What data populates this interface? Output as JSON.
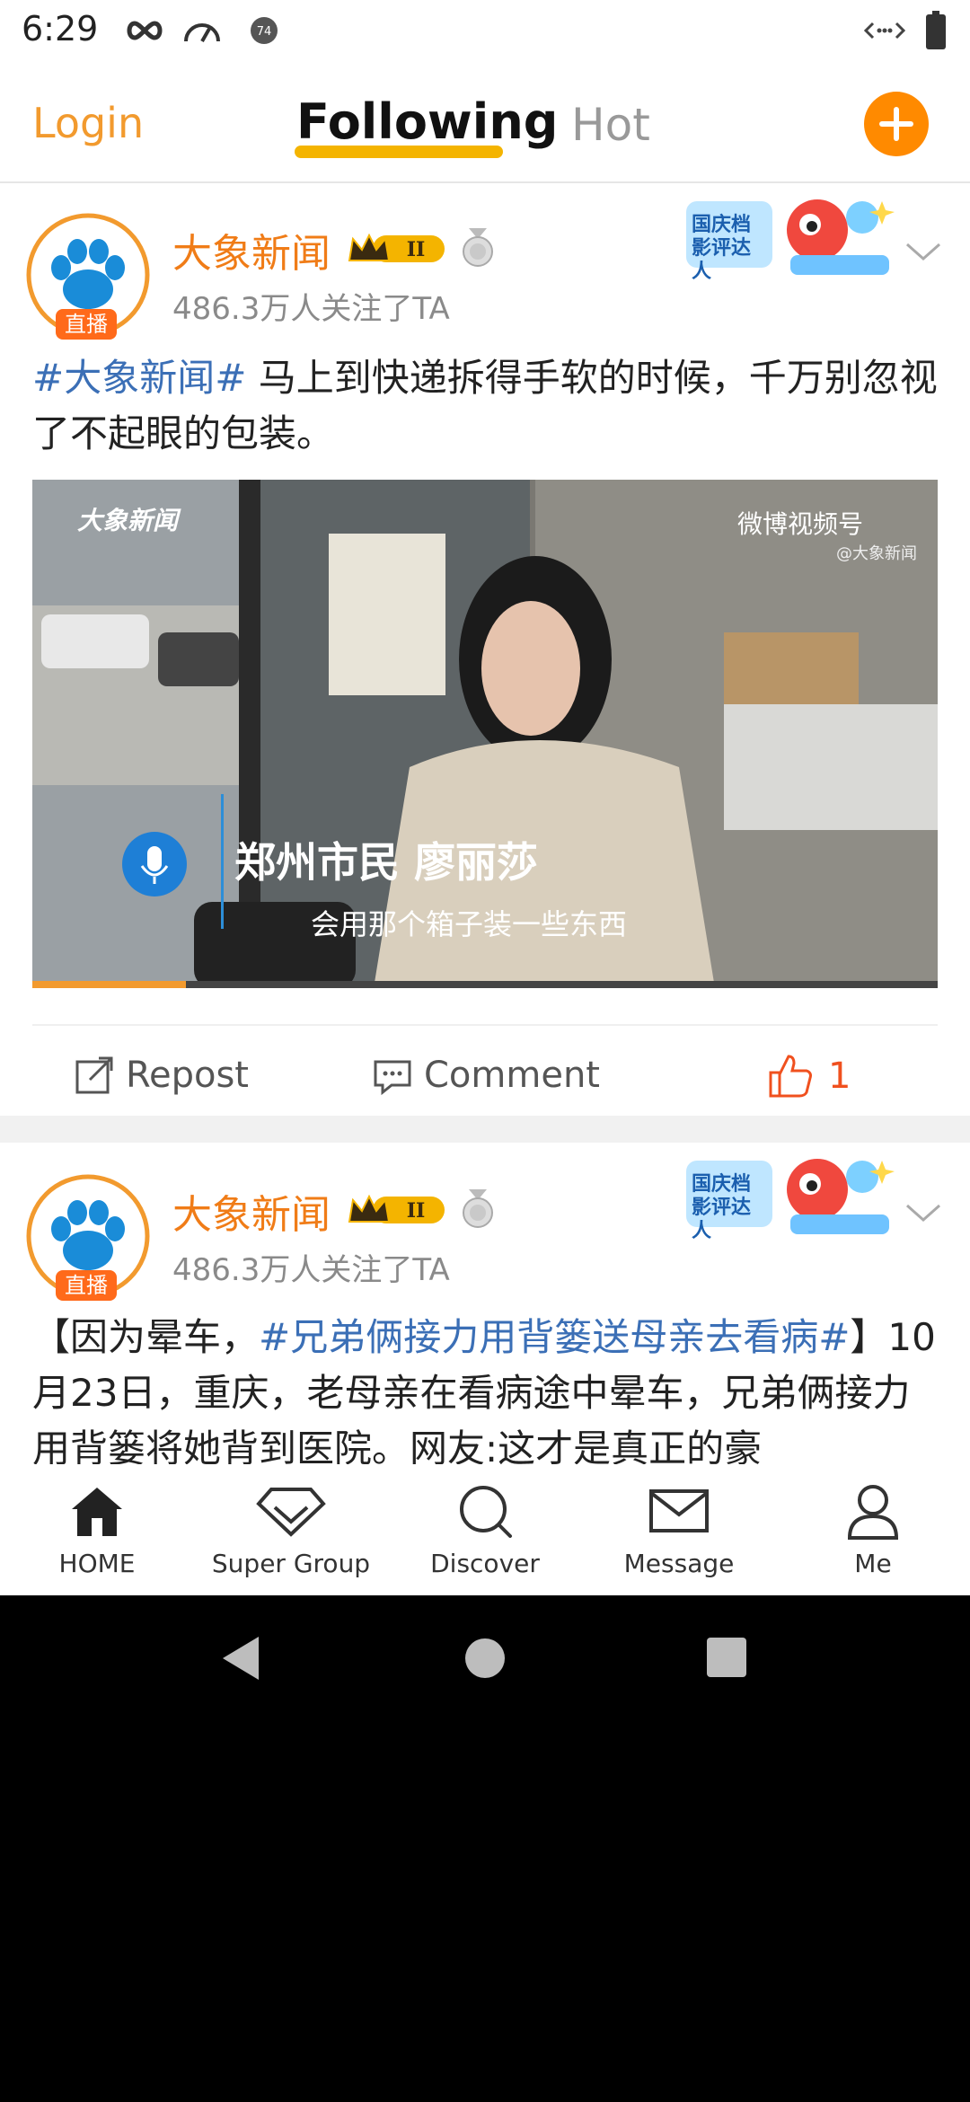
{
  "status_bar": {
    "time": "6:29"
  },
  "top_nav": {
    "login_label": "Login",
    "tabs": [
      {
        "label": "Following",
        "active": true
      },
      {
        "label": "Hot",
        "active": false
      }
    ],
    "accent_color": "#f29a2e"
  },
  "posts": [
    {
      "username": "大象新闻",
      "level_badge": "II",
      "live_badge": "直播",
      "followers": "486.3万人关注了TA",
      "hashtag": "#大象新闻#",
      "text": " 马上到快递拆得手软的时候，千万别忽视了不起眼的包装。",
      "promo_text": "国庆档影评达人",
      "video": {
        "logo_watermark": "大象新闻",
        "watermark": "微博视频号",
        "watermark_sub": "@大象新闻",
        "caption_name": "郑州市民 廖丽莎",
        "caption_subtitle": "会用那个箱子装一些东西",
        "progress": 0.17
      },
      "actions": {
        "repost_label": "Repost",
        "comment_label": "Comment",
        "like_count": "1"
      }
    },
    {
      "username": "大象新闻",
      "level_badge": "II",
      "live_badge": "直播",
      "followers": "486.3万人关注了TA",
      "text_prefix": "【因为晕车，",
      "hashtag": "#兄弟俩接力用背篓送母亲去看病#",
      "text_suffix": "】10月23日，重庆，老母亲在看病途中晕车，兄弟俩接力用背篓将她背到医院。网友:这才是真正的豪",
      "promo_text": "国庆档影评达人"
    }
  ],
  "tab_bar": {
    "items": [
      {
        "label": "HOME",
        "icon": "home-icon"
      },
      {
        "label": "Super Group",
        "icon": "diamond-icon"
      },
      {
        "label": "Discover",
        "icon": "search-icon"
      },
      {
        "label": "Message",
        "icon": "mail-icon"
      },
      {
        "label": "Me",
        "icon": "person-icon"
      }
    ]
  }
}
